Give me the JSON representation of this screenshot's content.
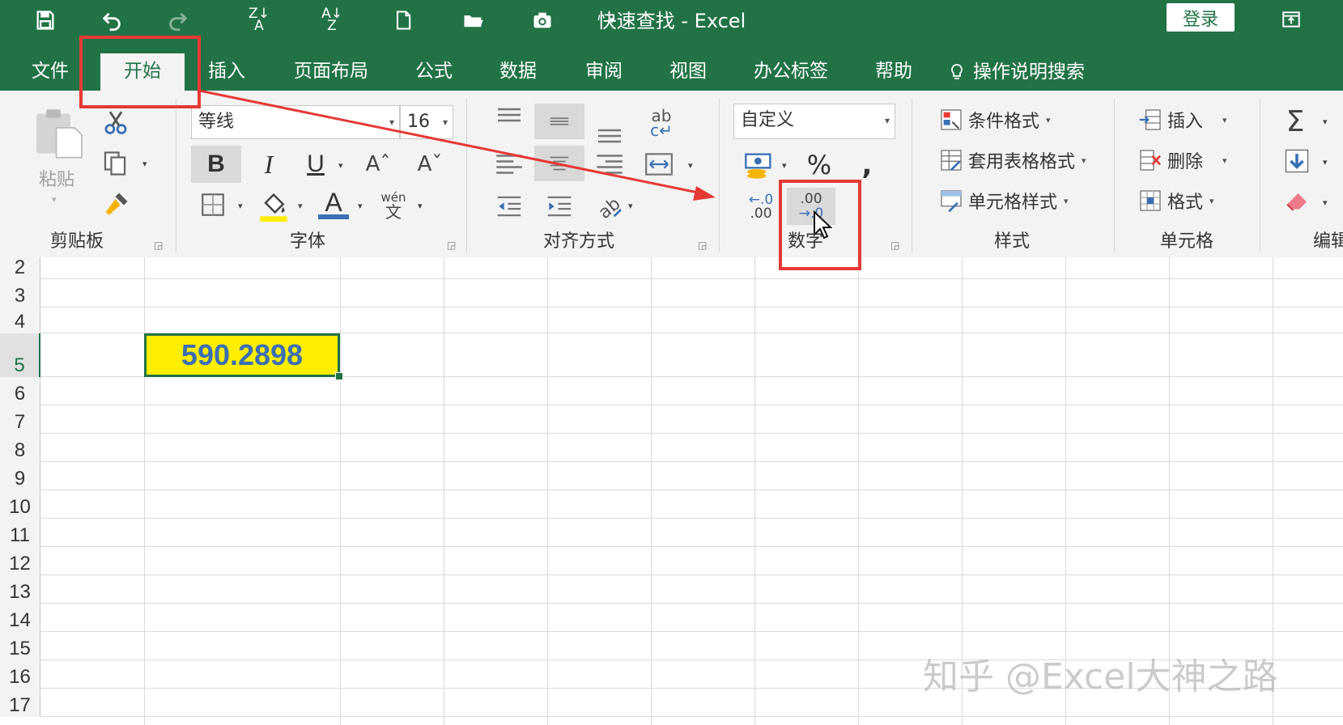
{
  "window": {
    "title": "快速查找  -  Excel",
    "login_label": "登录"
  },
  "tabs": [
    "文件",
    "开始",
    "插入",
    "页面布局",
    "公式",
    "数据",
    "审阅",
    "视图",
    "办公标签",
    "帮助"
  ],
  "tell_me": "操作说明搜索",
  "clipboard": {
    "paste_label": "粘贴",
    "group_label": "剪贴板"
  },
  "font": {
    "name": "等线",
    "size": "16",
    "phonetic_top": "wén",
    "phonetic_bottom": "文",
    "group_label": "字体"
  },
  "alignment": {
    "group_label": "对齐方式"
  },
  "number": {
    "format": "自定义",
    "group_label": "数字",
    "dec_inc_top": "←.0",
    "dec_inc_bottom": ".00",
    "dec_dec_top": ".00",
    "dec_dec_bottom": "→.0"
  },
  "styles": {
    "conditional": "条件格式",
    "table": "套用表格格式",
    "cell": "单元格样式",
    "group_label": "样式"
  },
  "cells": {
    "insert": "插入",
    "delete": "删除",
    "format": "格式",
    "group_label": "单元格"
  },
  "editing": {
    "group_label": "编辑"
  },
  "grid": {
    "row_numbers": [
      "2",
      "3",
      "4",
      "5",
      "6",
      "7",
      "8",
      "9",
      "10",
      "11",
      "12",
      "13",
      "14",
      "15",
      "16",
      "17"
    ],
    "active_cell_value": "590.2898",
    "active_cell_colors": {
      "fill": "#ffee00",
      "text": "#3a6fb4",
      "border": "#217346"
    }
  },
  "watermark": "知乎 @Excel大神之路",
  "colors": {
    "excel_green": "#217346",
    "annotation_red": "#e53935"
  }
}
